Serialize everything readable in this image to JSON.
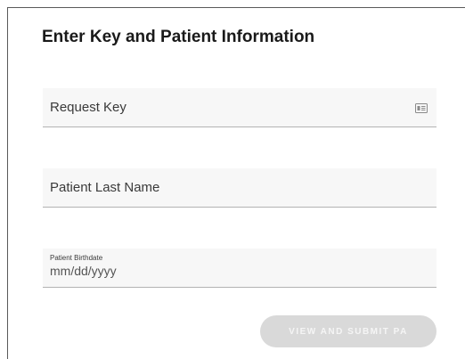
{
  "form": {
    "title": "Enter Key and Patient Information",
    "request_key": {
      "placeholder": "Request Key",
      "icon": "id-card-icon"
    },
    "last_name": {
      "placeholder": "Patient Last Name"
    },
    "birthdate": {
      "label": "Patient Birthdate",
      "placeholder": "mm/dd/yyyy"
    },
    "submit_label": "VIEW AND SUBMIT PA"
  },
  "colors": {
    "field_background": "#f7f7f7",
    "field_underline": "#b3b3b3",
    "button_disabled": "#d9d9d9"
  }
}
